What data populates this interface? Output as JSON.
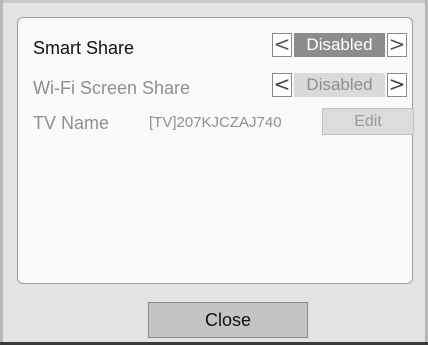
{
  "settings": {
    "smart_share": {
      "label": "Smart Share",
      "value": "Disabled",
      "prev_glyph": "<",
      "next_glyph": ">"
    },
    "wifi_screen_share": {
      "label": "Wi-Fi Screen Share",
      "value": "Disabled",
      "prev_glyph": "<",
      "next_glyph": ">"
    },
    "tv_name": {
      "label": "TV Name",
      "value": "[TV]207KJCZAJ740",
      "edit_label": "Edit"
    }
  },
  "footer": {
    "close_label": "Close"
  },
  "colors": {
    "frame": "#e3e3e3",
    "panel": "#fafafa",
    "selected_value": "#8c8c8c",
    "disabled_value": "#dadada",
    "close_button": "#c4c4c4"
  }
}
